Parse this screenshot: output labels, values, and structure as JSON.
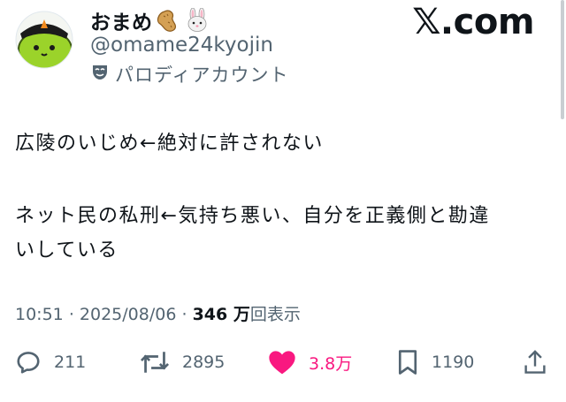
{
  "user": {
    "display_name": "おまめ",
    "handle": "@omame24kyojin",
    "parody_label": "パロディアカウント",
    "avatar_icon": "green-bean-character-avatar",
    "name_emojis": [
      "peanut-icon",
      "rabbit-face-icon"
    ]
  },
  "watermark": "𝕏.com",
  "tweet": {
    "lines": [
      "広陵のいじめ←絶対に許されない",
      "ネット民の私刑←気持ち悪い、自分を正義側と勘違",
      "いしている"
    ]
  },
  "meta": {
    "time": "10:51",
    "date": "2025/08/06",
    "separator": "·",
    "views_count": "346 万",
    "views_label": "回表示"
  },
  "actions": {
    "reply": {
      "icon": "reply-icon",
      "count": "211"
    },
    "retweet": {
      "icon": "retweet-icon",
      "count": "2895"
    },
    "like": {
      "icon": "heart-icon",
      "count": "3.8万",
      "active": true,
      "color": "#f91880"
    },
    "bookmark": {
      "icon": "bookmark-icon",
      "count": "1190"
    },
    "share": {
      "icon": "share-icon"
    }
  },
  "colors": {
    "text": "#0f1419",
    "secondary": "#536471",
    "like": "#f91880",
    "avatar_green": "#9bd32a"
  }
}
